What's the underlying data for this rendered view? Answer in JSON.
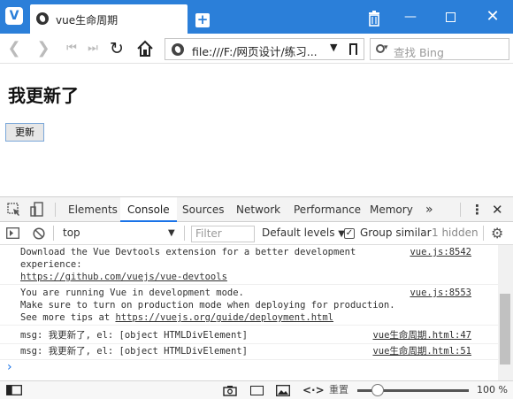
{
  "browser": {
    "tab_title": "vue生命周期",
    "url": "file:///F:/网页设计/练习...",
    "search_placeholder": "查找 Bing"
  },
  "page": {
    "heading": "我更新了",
    "button_label": "更新"
  },
  "devtools": {
    "tabs": [
      "Elements",
      "Console",
      "Sources",
      "Network",
      "Performance",
      "Memory"
    ],
    "more": "»",
    "context": "top",
    "filter_placeholder": "Filter",
    "levels": "Default levels",
    "group_similar": "Group similar",
    "hidden": "1 hidden"
  },
  "console": {
    "messages": [
      {
        "line1": "Download the Vue Devtools extension for a better development",
        "line2": "experience:",
        "link": "https://github.com/vuejs/vue-devtools",
        "source": "vue.js:8542"
      },
      {
        "line1": "You are running Vue in development mode.",
        "line2": "Make sure to turn on production mode when deploying for production.",
        "line3_prefix": "See more tips at ",
        "link": "https://vuejs.org/guide/deployment.html",
        "source": "vue.js:8553"
      },
      {
        "text": "msg: 我更新了, el: [object HTMLDivElement]",
        "source": "vue生命周期.html:47"
      },
      {
        "text": "msg: 我更新了, el: [object HTMLDivElement]",
        "source": "vue生命周期.html:51"
      }
    ],
    "prompt": "›"
  },
  "status": {
    "reset": "重置",
    "zoom": "100 %"
  }
}
